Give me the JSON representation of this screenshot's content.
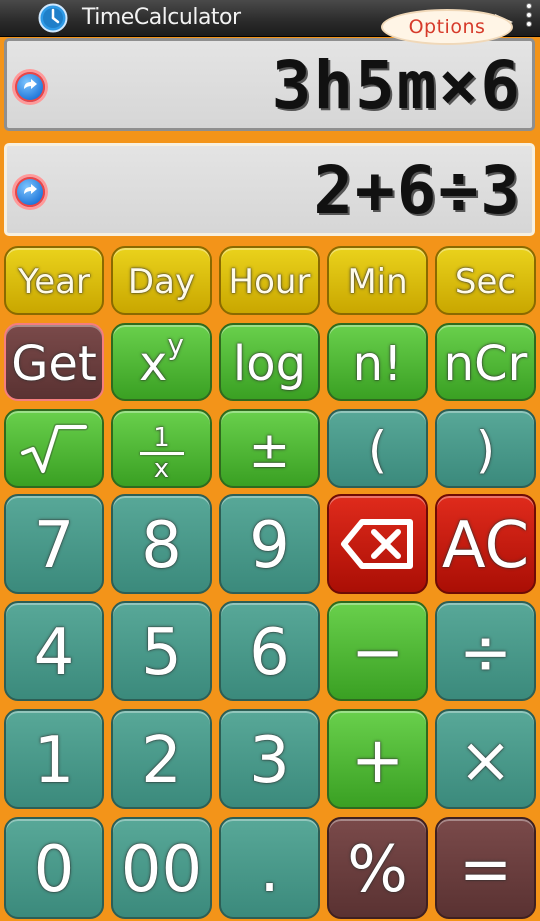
{
  "app": {
    "title": "TimeCalculator",
    "options_label": "Options",
    "icon": "clock-icon",
    "overflow_icon": "overflow-menu-icon"
  },
  "displays": {
    "primary": {
      "text": "3h5m×6",
      "icon": "arrow-icon"
    },
    "secondary": {
      "text": "2+6÷3",
      "icon": "arrow-icon"
    }
  },
  "units": [
    "Year",
    "Day",
    "Hour",
    "Min",
    "Sec"
  ],
  "functions": {
    "get": "Get",
    "pow_base": "x",
    "pow_exp": "y",
    "log": "log",
    "factorial": "n!",
    "ncr": "nCr",
    "sqrt_icon": "square-root-icon",
    "reciprocal_num": "1",
    "reciprocal_den": "x",
    "plus_minus": "±",
    "lparen": "(",
    "rparen": ")"
  },
  "keys": {
    "seven": "7",
    "eight": "8",
    "nine": "9",
    "backspace_icon": "backspace-icon",
    "clear": "AC",
    "four": "4",
    "five": "5",
    "six": "6",
    "minus": "−",
    "divide": "÷",
    "one": "1",
    "two": "2",
    "three": "3",
    "plus": "+",
    "multiply": "×",
    "zero": "0",
    "double_zero": "00",
    "dot": ".",
    "percent": "%",
    "equals": "="
  },
  "colors": {
    "background": "#f39419",
    "unit_button": "#dcc00e",
    "function_button": "#52b838",
    "digit_button": "#4a9a8a",
    "danger_button": "#c81c10",
    "special_button": "#6a3e3e",
    "options_text": "#d63a2a"
  }
}
